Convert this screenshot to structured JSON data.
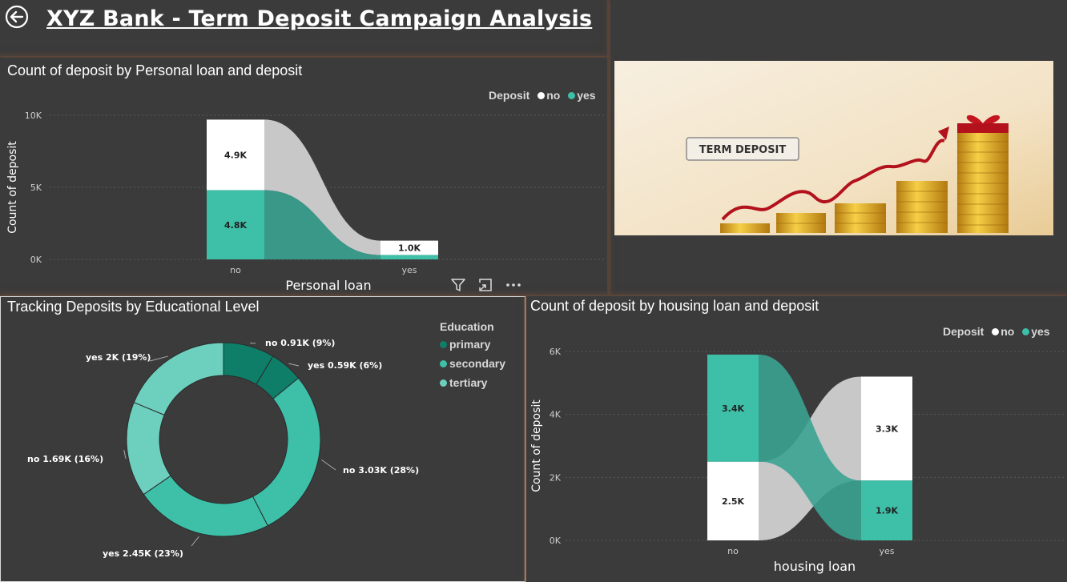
{
  "header": {
    "title": "XYZ Bank - Term Deposit Campaign Analysis"
  },
  "colors": {
    "no": "#ffffff",
    "yes": "#3dbfa8",
    "primary": "#0e7e69",
    "secondary": "#3dbfa8",
    "tertiary": "#6dd0bf"
  },
  "image": {
    "caption": "TERM DEPOSIT"
  },
  "toolbar": {
    "filter_icon": "filter-icon",
    "focus_icon": "focus-mode-icon",
    "more_icon": "more-options-icon"
  },
  "chart_data": [
    {
      "type": "ribbon",
      "title": "Count of deposit by Personal loan and deposit",
      "xlabel": "Personal loan",
      "ylabel": "Count of deposit",
      "categories": [
        "no",
        "yes"
      ],
      "yticks": [
        "10K",
        "5K",
        "0K"
      ],
      "ylim": [
        0,
        10000
      ],
      "legend": {
        "title": "Deposit",
        "items": [
          "no",
          "yes"
        ]
      },
      "series": [
        {
          "name": "no",
          "values": [
            4900,
            1000
          ],
          "labels": [
            "4.9K",
            "1.0K"
          ]
        },
        {
          "name": "yes",
          "values": [
            4800,
            300
          ],
          "labels": [
            "4.8K",
            ""
          ]
        }
      ]
    },
    {
      "type": "pie",
      "title": "Tracking Deposits by Educational Level",
      "legend": {
        "title": "Education",
        "items": [
          "primary",
          "secondary",
          "tertiary"
        ]
      },
      "slices": [
        {
          "education": "primary",
          "deposit": "no",
          "value": 0.91,
          "pct": 9,
          "label": "no 0.91K (9%)"
        },
        {
          "education": "primary",
          "deposit": "yes",
          "value": 0.59,
          "pct": 6,
          "label": "yes 0.59K (6%)"
        },
        {
          "education": "secondary",
          "deposit": "no",
          "value": 3.03,
          "pct": 28,
          "label": "no 3.03K (28%)"
        },
        {
          "education": "secondary",
          "deposit": "yes",
          "value": 2.45,
          "pct": 23,
          "label": "yes 2.45K (23%)"
        },
        {
          "education": "tertiary",
          "deposit": "no",
          "value": 1.69,
          "pct": 16,
          "label": "no 1.69K (16%)"
        },
        {
          "education": "tertiary",
          "deposit": "yes",
          "value": 2.0,
          "pct": 19,
          "label": "yes 2K (19%)"
        }
      ]
    },
    {
      "type": "ribbon",
      "title": "Count of deposit by housing loan and deposit",
      "xlabel": "housing loan",
      "ylabel": "Count of deposit",
      "categories": [
        "no",
        "yes"
      ],
      "yticks": [
        "6K",
        "4K",
        "2K",
        "0K"
      ],
      "ylim": [
        0,
        6000
      ],
      "legend": {
        "title": "Deposit",
        "items": [
          "no",
          "yes"
        ]
      },
      "series": [
        {
          "name": "no",
          "values": [
            2500,
            3300
          ],
          "labels": [
            "2.5K",
            "3.3K"
          ]
        },
        {
          "name": "yes",
          "values": [
            3400,
            1900
          ],
          "labels": [
            "3.4K",
            "1.9K"
          ]
        }
      ]
    }
  ]
}
